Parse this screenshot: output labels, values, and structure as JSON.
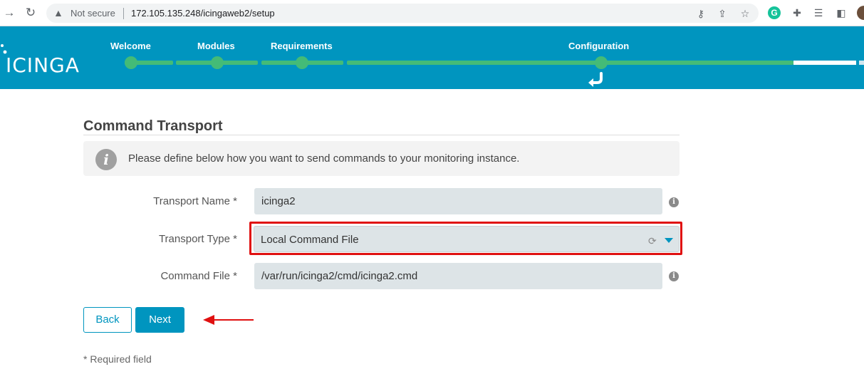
{
  "browser": {
    "security_label": "Not secure",
    "url": "172.105.135.248/icingaweb2/setup"
  },
  "brand": {
    "logo_text": "icinga",
    "accent_color": "#0095bf",
    "progress_color": "#44bb77"
  },
  "wizard": {
    "steps": [
      {
        "label": "Welcome"
      },
      {
        "label": "Modules"
      },
      {
        "label": "Requirements"
      },
      {
        "label": "Configuration"
      }
    ]
  },
  "form": {
    "title": "Command Transport",
    "info_text": "Please define below how you want to send commands to your monitoring instance.",
    "transport_name": {
      "label": "Transport Name *",
      "value": "icinga2"
    },
    "transport_type": {
      "label": "Transport Type *",
      "value": "Local Command File"
    },
    "command_file": {
      "label": "Command File *",
      "value": "/var/run/icinga2/cmd/icinga2.cmd"
    },
    "back_label": "Back",
    "next_label": "Next",
    "required_note": "* Required field"
  },
  "annotation": {
    "highlight_color": "#e01010"
  }
}
